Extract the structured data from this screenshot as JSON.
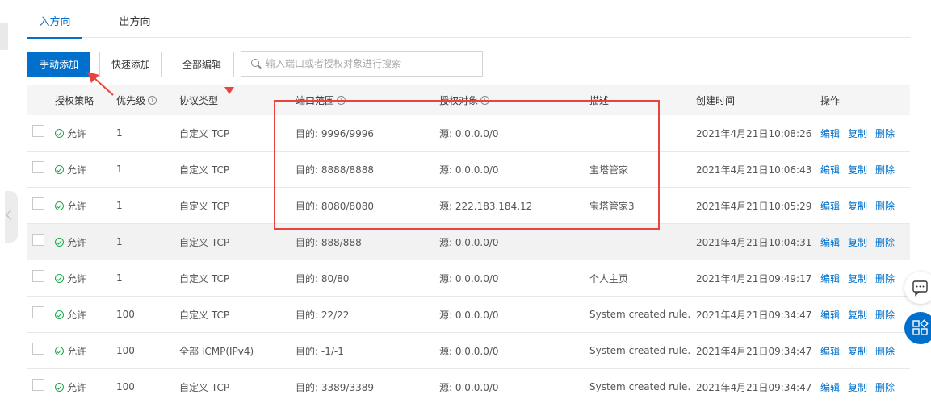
{
  "tabs": [
    {
      "label": "入方向"
    },
    {
      "label": "出方向"
    }
  ],
  "toolbar": {
    "manual_add": "手动添加",
    "quick_add": "快速添加",
    "bulk_edit": "全部编辑",
    "search_placeholder": "输入端口或者授权对象进行搜索"
  },
  "table": {
    "headers": {
      "policy": "授权策略",
      "priority": "优先级",
      "protocol": "协议类型",
      "port_range": "端口范围",
      "auth_object": "授权对象",
      "description": "描述",
      "created": "创建时间",
      "ops": "操作"
    },
    "ops": {
      "edit": "编辑",
      "copy": "复制",
      "delete": "删除"
    },
    "rows": [
      {
        "policy": "允许",
        "priority": "1",
        "protocol": "自定义 TCP",
        "port": "目的: 9996/9996",
        "auth": "源: 0.0.0.0/0",
        "desc": "",
        "time": "2021年4月21日10:08:26"
      },
      {
        "policy": "允许",
        "priority": "1",
        "protocol": "自定义 TCP",
        "port": "目的: 8888/8888",
        "auth": "源: 0.0.0.0/0",
        "desc": "宝塔管家",
        "time": "2021年4月21日10:06:43"
      },
      {
        "policy": "允许",
        "priority": "1",
        "protocol": "自定义 TCP",
        "port": "目的: 8080/8080",
        "auth": "源: 222.183.184.12",
        "desc": "宝塔管家3",
        "time": "2021年4月21日10:05:29"
      },
      {
        "policy": "允许",
        "priority": "1",
        "protocol": "自定义 TCP",
        "port": "目的: 888/888",
        "auth": "源: 0.0.0.0/0",
        "desc": "",
        "time": "2021年4月21日10:04:31"
      },
      {
        "policy": "允许",
        "priority": "1",
        "protocol": "自定义 TCP",
        "port": "目的: 80/80",
        "auth": "源: 0.0.0.0/0",
        "desc": "个人主页",
        "time": "2021年4月21日09:49:17"
      },
      {
        "policy": "允许",
        "priority": "100",
        "protocol": "自定义 TCP",
        "port": "目的: 22/22",
        "auth": "源: 0.0.0.0/0",
        "desc": "System created rule.",
        "time": "2021年4月21日09:34:47"
      },
      {
        "policy": "允许",
        "priority": "100",
        "protocol": "全部 ICMP(IPv4)",
        "port": "目的: -1/-1",
        "auth": "源: 0.0.0.0/0",
        "desc": "System created rule.",
        "time": "2021年4月21日09:34:47"
      },
      {
        "policy": "允许",
        "priority": "100",
        "protocol": "自定义 TCP",
        "port": "目的: 3389/3389",
        "auth": "源: 0.0.0.0/0",
        "desc": "System created rule.",
        "time": "2021年4月21日09:34:47"
      }
    ]
  },
  "colors": {
    "primary": "#0070cc",
    "annotation": "#e8433f",
    "allow": "#1aa64a"
  }
}
